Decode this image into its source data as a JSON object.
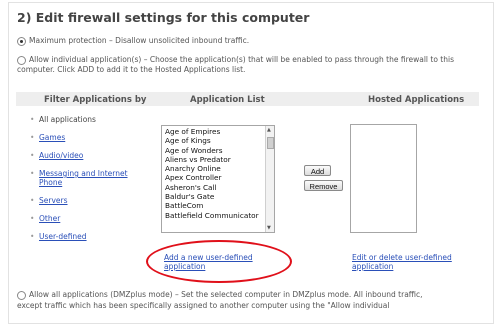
{
  "section": {
    "title": "2) Edit firewall settings for this computer",
    "max_protection": "Maximum protection – Disallow unsolicited inbound traffic.",
    "allow_individual": "Allow individual application(s) – Choose the application(s) that will be enabled to pass through the firewall to this computer. Click ADD to add it to the Hosted Applications list.",
    "allow_all_line1": "Allow all applications (DMZplus mode) – Set the selected computer in DMZplus mode. All inbound traffic,",
    "allow_all_line2": "except traffic which has been specifically assigned to another computer using the \"Allow individual"
  },
  "columns": {
    "filter": "Filter Applications by",
    "app_list": "Application List",
    "hosted": "Hosted Applications"
  },
  "filters": [
    "All applications",
    "Games",
    "Audio/video",
    "Messaging and Internet Phone",
    "Servers",
    "Other",
    "User-defined"
  ],
  "applications": [
    "Age of Empires",
    "Age of Kings",
    "Age of Wonders",
    "Aliens vs Predator",
    "Anarchy Online",
    "Apex Controller",
    "Asheron's Call",
    "Baldur's Gate",
    "BattleCom",
    "Battlefield Communicator"
  ],
  "buttons": {
    "add": "Add",
    "remove": "Remove"
  },
  "links": {
    "add_user_defined": "Add a new user-defined application",
    "edit_user_defined": "Edit or delete user-defined application"
  },
  "colors": {
    "link": "#2a4fb8",
    "highlight_oval": "#e0101a"
  }
}
